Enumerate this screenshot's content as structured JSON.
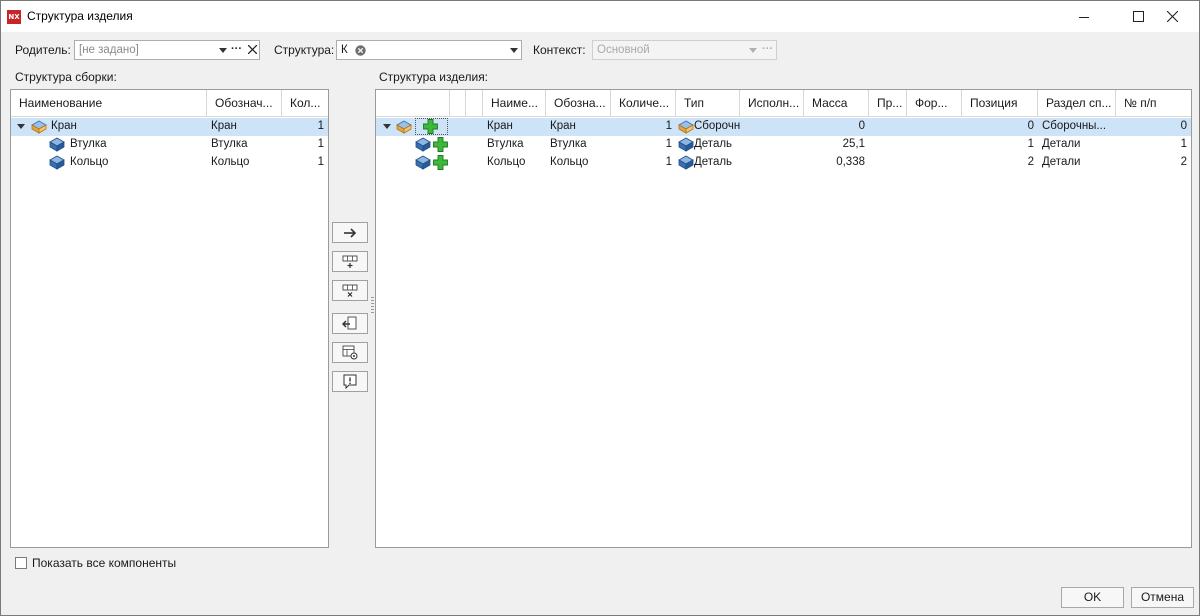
{
  "window": {
    "title": "Структура изделия",
    "app_badge": "NX"
  },
  "toolbar": {
    "parent_label": "Родитель:",
    "parent_placeholder": "[не задано]",
    "structure_label": "Структура:",
    "structure_value": "К",
    "context_label": "Контекст:",
    "context_placeholder": "Основной",
    "more": "···"
  },
  "left_panel": {
    "title": "Структура сборки:",
    "columns": [
      "Наименование",
      "Обознач...",
      "Кол..."
    ],
    "rows": [
      {
        "name": "Кран",
        "designation": "Кран",
        "qty": "1"
      },
      {
        "name": "Втулка",
        "designation": "Втулка",
        "qty": "1"
      },
      {
        "name": "Кольцо",
        "designation": "Кольцо",
        "qty": "1"
      }
    ]
  },
  "right_panel": {
    "title": "Структура изделия:",
    "columns": [
      "Наиме...",
      "Обозна...",
      "Количе...",
      "Тип",
      "Исполн...",
      "Масса",
      "Пр...",
      "Фор...",
      "Позиция",
      "Раздел сп...",
      "№ п/п"
    ],
    "rows": [
      {
        "name": "Кран",
        "designation": "Кран",
        "qty": "1",
        "type": "Сборочн",
        "mass": "0",
        "position": "0",
        "section": "Сборочны...",
        "num": "0"
      },
      {
        "name": "Втулка",
        "designation": "Втулка",
        "qty": "1",
        "type": "Деталь",
        "mass": "25,1",
        "position": "1",
        "section": "Детали",
        "num": "1"
      },
      {
        "name": "Кольцо",
        "designation": "Кольцо",
        "qty": "1",
        "type": "Деталь",
        "mass": "0,338",
        "position": "2",
        "section": "Детали",
        "num": "2"
      }
    ]
  },
  "bottom": {
    "show_all_label": "Показать все компоненты",
    "ok_label": "OK",
    "cancel_label": "Отмена"
  },
  "colors": {
    "selection": "#cde3f7",
    "part_blue": "#3a6fb0",
    "assembly_orange": "#e8a33c",
    "add_green": "#3cb83c"
  }
}
